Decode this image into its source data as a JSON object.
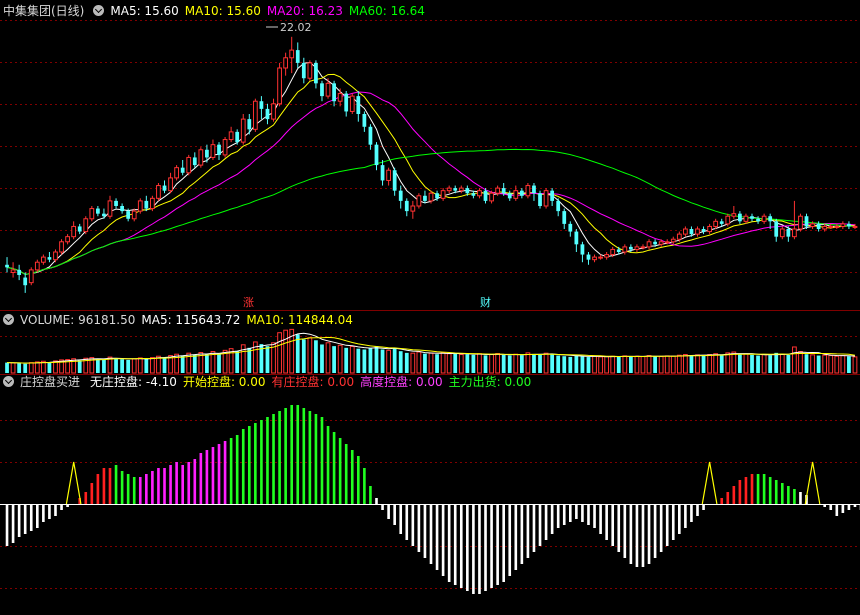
{
  "colors": {
    "up": "#ff3232",
    "down": "#54ffff",
    "ma5": "#ffffff",
    "ma10": "#ffff00",
    "ma20": "#ff00ff",
    "ma60": "#00ff00",
    "grid": "#7f0000",
    "zero": "#ffffff",
    "phase_red": "#ff2020",
    "phase_green": "#20ff20",
    "phase_magenta": "#ff20ff",
    "phase_white": "#ffffff",
    "phase_yellow": "#ffff00"
  },
  "price_panel": {
    "title": "中集集团(日线)",
    "ma5": "MA5: 15.60",
    "ma10": "MA10: 15.60",
    "ma20": "MA20: 16.23",
    "ma60": "MA60: 16.64",
    "peak_label": "22.02",
    "markers": [
      {
        "bar": 44,
        "text": "涨"
      },
      {
        "bar": 90,
        "text": "财"
      }
    ]
  },
  "volume_panel": {
    "label": "VOLUME: 96181.50",
    "ma5": "MA5: 115643.72",
    "ma10": "MA10: 114844.04"
  },
  "indicator_panel": {
    "name": "庄控盘买进",
    "no_control": "无庄控盘: -4.10",
    "start_control": "开始控盘: 0.00",
    "has_control": "有庄控盘: 0.00",
    "high_control": "高度控盘: 0.00",
    "main_out": "主力出货: 0.00"
  },
  "chart_data": [
    {
      "type": "candlestick",
      "title": "中集集团(日线)",
      "annotation_high": 22.02,
      "ohlc_normalized_note": "",
      "candles": [
        [
          13.1,
          13.0,
          12.8,
          13.4
        ],
        [
          12.8,
          12.9,
          12.6,
          13.2
        ],
        [
          12.9,
          12.7,
          12.5,
          13.1
        ],
        [
          12.6,
          12.3,
          12.0,
          12.8
        ],
        [
          12.4,
          12.9,
          12.3,
          13.0
        ],
        [
          12.9,
          13.2,
          12.8,
          13.3
        ],
        [
          13.2,
          13.4,
          13.1,
          13.5
        ],
        [
          13.4,
          13.3,
          13.2,
          13.6
        ],
        [
          13.3,
          13.6,
          13.2,
          13.7
        ],
        [
          13.6,
          14.0,
          13.5,
          14.1
        ],
        [
          14.0,
          14.2,
          13.9,
          14.3
        ],
        [
          14.2,
          14.6,
          14.1,
          14.8
        ],
        [
          14.6,
          14.4,
          14.3,
          14.7
        ],
        [
          14.4,
          14.9,
          14.3,
          15.0
        ],
        [
          14.9,
          15.3,
          14.8,
          15.4
        ],
        [
          15.3,
          15.1,
          15.0,
          15.4
        ],
        [
          15.1,
          15.0,
          14.9,
          15.3
        ],
        [
          15.0,
          15.6,
          14.9,
          15.8
        ],
        [
          15.6,
          15.4,
          15.3,
          15.7
        ],
        [
          15.4,
          15.2,
          15.1,
          15.5
        ],
        [
          15.2,
          14.9,
          14.8,
          15.3
        ],
        [
          14.9,
          15.2,
          14.8,
          15.3
        ],
        [
          15.2,
          15.6,
          15.1,
          15.7
        ],
        [
          15.6,
          15.3,
          15.2,
          15.8
        ],
        [
          15.3,
          15.7,
          15.2,
          15.8
        ],
        [
          15.7,
          16.2,
          15.6,
          16.3
        ],
        [
          16.2,
          16.0,
          15.9,
          16.4
        ],
        [
          16.0,
          16.5,
          15.9,
          16.7
        ],
        [
          16.5,
          16.9,
          16.4,
          17.0
        ],
        [
          16.9,
          16.7,
          16.6,
          17.2
        ],
        [
          16.7,
          17.3,
          16.6,
          17.4
        ],
        [
          17.3,
          17.0,
          16.9,
          17.5
        ],
        [
          17.0,
          17.6,
          16.9,
          17.7
        ],
        [
          17.6,
          17.3,
          17.1,
          17.8
        ],
        [
          17.3,
          17.8,
          17.2,
          18.0
        ],
        [
          17.8,
          17.4,
          17.2,
          17.9
        ],
        [
          17.4,
          18.0,
          17.3,
          18.1
        ],
        [
          18.0,
          18.3,
          17.9,
          18.5
        ],
        [
          18.3,
          17.9,
          17.8,
          18.4
        ],
        [
          17.9,
          18.8,
          17.8,
          19.0
        ],
        [
          18.8,
          18.4,
          18.2,
          19.0
        ],
        [
          18.4,
          19.5,
          18.3,
          19.6
        ],
        [
          19.5,
          19.2,
          18.8,
          19.7
        ],
        [
          19.2,
          18.8,
          18.6,
          19.4
        ],
        [
          18.8,
          19.4,
          18.7,
          19.6
        ],
        [
          19.4,
          20.8,
          19.3,
          21.0
        ],
        [
          20.8,
          21.2,
          20.5,
          21.4
        ],
        [
          21.2,
          21.5,
          20.6,
          22.02
        ],
        [
          21.5,
          21.0,
          20.8,
          21.8
        ],
        [
          21.0,
          20.4,
          20.2,
          21.2
        ],
        [
          20.4,
          21.0,
          20.3,
          21.1
        ],
        [
          21.0,
          20.2,
          20.0,
          21.1
        ],
        [
          20.2,
          19.7,
          19.5,
          20.3
        ],
        [
          19.7,
          20.2,
          19.6,
          20.4
        ],
        [
          20.2,
          19.5,
          19.3,
          20.3
        ],
        [
          19.5,
          19.8,
          19.3,
          20.0
        ],
        [
          19.8,
          19.1,
          18.9,
          19.9
        ],
        [
          19.1,
          19.7,
          19.0,
          19.8
        ],
        [
          19.7,
          19.0,
          18.7,
          19.9
        ],
        [
          19.0,
          18.5,
          18.3,
          19.1
        ],
        [
          18.5,
          17.8,
          17.6,
          18.6
        ],
        [
          17.8,
          17.0,
          16.8,
          17.9
        ],
        [
          17.0,
          16.4,
          16.2,
          17.2
        ],
        [
          16.4,
          16.8,
          16.2,
          16.9
        ],
        [
          16.8,
          16.0,
          15.8,
          16.9
        ],
        [
          16.0,
          15.6,
          15.3,
          16.2
        ],
        [
          15.6,
          15.2,
          15.0,
          15.7
        ],
        [
          15.2,
          15.4,
          14.9,
          15.6
        ],
        [
          15.4,
          15.8,
          15.3,
          15.9
        ],
        [
          15.8,
          15.6,
          15.5,
          16.0
        ],
        [
          15.6,
          15.9,
          15.5,
          16.0
        ],
        [
          15.9,
          15.7,
          15.6,
          16.0
        ],
        [
          15.7,
          16.0,
          15.6,
          16.1
        ],
        [
          16.0,
          16.1,
          15.9,
          16.2
        ],
        [
          16.1,
          16.0,
          15.9,
          16.2
        ],
        [
          16.0,
          16.1,
          15.9,
          16.2
        ],
        [
          16.1,
          15.9,
          15.8,
          16.2
        ],
        [
          15.9,
          15.8,
          15.7,
          16.0
        ],
        [
          15.8,
          16.0,
          15.7,
          16.1
        ],
        [
          16.0,
          15.6,
          15.5,
          16.1
        ],
        [
          15.6,
          15.9,
          15.5,
          16.0
        ],
        [
          15.9,
          16.1,
          15.8,
          16.2
        ],
        [
          16.1,
          15.9,
          15.8,
          16.3
        ],
        [
          15.9,
          15.7,
          15.6,
          16.0
        ],
        [
          15.7,
          16.0,
          15.6,
          16.2
        ],
        [
          16.0,
          15.8,
          15.7,
          16.1
        ],
        [
          15.8,
          16.2,
          15.7,
          16.3
        ],
        [
          16.2,
          15.9,
          15.6,
          16.3
        ],
        [
          15.9,
          15.4,
          15.3,
          16.0
        ],
        [
          15.4,
          16.0,
          15.3,
          16.1
        ],
        [
          16.0,
          15.6,
          15.4,
          16.1
        ],
        [
          15.6,
          15.2,
          15.0,
          15.7
        ],
        [
          15.2,
          14.7,
          14.5,
          15.3
        ],
        [
          14.7,
          14.4,
          14.2,
          14.8
        ],
        [
          14.4,
          13.9,
          13.6,
          14.5
        ],
        [
          13.9,
          13.5,
          13.2,
          14.0
        ],
        [
          13.5,
          13.3,
          13.1,
          13.6
        ],
        [
          13.3,
          13.4,
          13.2,
          13.5
        ],
        [
          13.4,
          13.4,
          13.3,
          13.5
        ],
        [
          13.4,
          13.5,
          13.3,
          13.6
        ],
        [
          13.5,
          13.7,
          13.4,
          13.8
        ],
        [
          13.7,
          13.6,
          13.5,
          13.8
        ],
        [
          13.6,
          13.8,
          13.5,
          13.9
        ],
        [
          13.8,
          13.7,
          13.6,
          13.9
        ],
        [
          13.7,
          13.8,
          13.6,
          13.9
        ],
        [
          13.8,
          13.8,
          13.7,
          13.9
        ],
        [
          13.8,
          14.0,
          13.7,
          14.1
        ],
        [
          14.0,
          13.9,
          13.8,
          14.1
        ],
        [
          13.9,
          14.0,
          13.8,
          14.1
        ],
        [
          14.0,
          14.0,
          13.9,
          14.1
        ],
        [
          14.0,
          14.1,
          13.9,
          14.2
        ],
        [
          14.1,
          14.3,
          14.0,
          14.4
        ],
        [
          14.3,
          14.5,
          14.2,
          14.6
        ],
        [
          14.5,
          14.3,
          14.2,
          14.6
        ],
        [
          14.3,
          14.5,
          14.2,
          14.6
        ],
        [
          14.5,
          14.4,
          14.3,
          14.6
        ],
        [
          14.4,
          14.6,
          14.3,
          14.7
        ],
        [
          14.6,
          14.8,
          14.5,
          14.9
        ],
        [
          14.8,
          14.7,
          14.6,
          14.9
        ],
        [
          14.7,
          15.0,
          14.6,
          15.1
        ],
        [
          15.0,
          15.1,
          14.9,
          15.4
        ],
        [
          15.1,
          14.8,
          14.7,
          15.2
        ],
        [
          14.8,
          15.0,
          14.7,
          15.1
        ],
        [
          15.0,
          14.9,
          14.8,
          15.1
        ],
        [
          14.9,
          14.8,
          14.7,
          15.0
        ],
        [
          14.8,
          15.0,
          14.7,
          15.1
        ],
        [
          15.0,
          14.8,
          14.5,
          15.1
        ],
        [
          14.8,
          14.2,
          14.0,
          14.9
        ],
        [
          14.2,
          14.5,
          14.1,
          14.6
        ],
        [
          14.5,
          14.2,
          14.0,
          14.6
        ],
        [
          14.2,
          14.5,
          14.1,
          15.6
        ],
        [
          14.5,
          15.0,
          14.4,
          15.1
        ],
        [
          15.0,
          14.6,
          14.5,
          15.1
        ],
        [
          14.6,
          14.7,
          14.5,
          14.8
        ],
        [
          14.7,
          14.5,
          14.4,
          14.8
        ],
        [
          14.5,
          14.6,
          14.4,
          14.7
        ],
        [
          14.6,
          14.6,
          14.5,
          14.7
        ],
        [
          14.6,
          14.6,
          14.5,
          14.7
        ],
        [
          14.6,
          14.7,
          14.5,
          14.8
        ],
        [
          14.7,
          14.6,
          14.5,
          14.8
        ],
        [
          14.6,
          14.6,
          14.5,
          14.7
        ]
      ],
      "ma5_ref": 15.6,
      "ma10_ref": 15.6,
      "ma20_ref": 16.23,
      "ma60_ref": 16.64,
      "ylim": [
        11.8,
        22.6
      ]
    },
    {
      "type": "bar",
      "title": "VOLUME",
      "last": 96181.5,
      "ma5": 115643.72,
      "ma10": 114844.04,
      "values": [
        62,
        60,
        58,
        55,
        62,
        66,
        70,
        64,
        72,
        78,
        80,
        85,
        75,
        88,
        92,
        86,
        80,
        95,
        88,
        82,
        78,
        84,
        90,
        86,
        92,
        100,
        94,
        104,
        112,
        105,
        118,
        108,
        122,
        112,
        128,
        115,
        135,
        145,
        130,
        168,
        150,
        185,
        172,
        160,
        180,
        240,
        255,
        260,
        230,
        200,
        210,
        195,
        170,
        180,
        160,
        165,
        150,
        158,
        145,
        140,
        150,
        160,
        140,
        135,
        150,
        130,
        120,
        118,
        125,
        115,
        118,
        112,
        120,
        115,
        118,
        110,
        112,
        108,
        115,
        105,
        110,
        116,
        108,
        104,
        112,
        106,
        120,
        112,
        108,
        118,
        110,
        104,
        100,
        96,
        105,
        98,
        95,
        100,
        96,
        98,
        100,
        97,
        102,
        98,
        100,
        98,
        104,
        100,
        98,
        102,
        100,
        106,
        110,
        104,
        108,
        105,
        110,
        115,
        108,
        120,
        125,
        110,
        114,
        108,
        104,
        110,
        106,
        120,
        112,
        108,
        155,
        128,
        112,
        108,
        104,
        106,
        104,
        100,
        104,
        100,
        96
      ],
      "ylim": [
        0,
        280
      ]
    },
    {
      "type": "bar",
      "title": "庄控盘买进",
      "values": [
        -14,
        -13,
        -11,
        -10,
        -9,
        -8,
        -6,
        -5,
        -4,
        -2,
        -1,
        0,
        2,
        4,
        7,
        10,
        12,
        12,
        13,
        11,
        10,
        9,
        9,
        10,
        11,
        12,
        12,
        13,
        14,
        13,
        14,
        15,
        17,
        18,
        19,
        20,
        21,
        22,
        23,
        25,
        26,
        27,
        28,
        29,
        30,
        31,
        32,
        33,
        33,
        32,
        31,
        30,
        29,
        26,
        24,
        22,
        20,
        18,
        16,
        12,
        6,
        2,
        -2,
        -5,
        -7,
        -10,
        -12,
        -14,
        -16,
        -18,
        -20,
        -22,
        -24,
        -26,
        -27,
        -28,
        -29,
        -30,
        -30,
        -29,
        -28,
        -27,
        -26,
        -24,
        -22,
        -20,
        -18,
        -16,
        -14,
        -12,
        -10,
        -8,
        -7,
        -6,
        -5,
        -6,
        -7,
        -8,
        -10,
        -12,
        -14,
        -16,
        -18,
        -20,
        -21,
        -21,
        -20,
        -18,
        -16,
        -14,
        -12,
        -10,
        -8,
        -6,
        -4,
        -2,
        -1,
        0,
        2,
        4,
        6,
        8,
        9,
        10,
        10,
        10,
        9,
        8,
        7,
        6,
        5,
        4,
        3,
        1,
        0,
        -1,
        -2,
        -4,
        -3,
        -2,
        -1,
        -2,
        -3,
        -3,
        -4.1
      ],
      "phase": [
        "white",
        "white",
        "white",
        "white",
        "white",
        "white",
        "white",
        "white",
        "white",
        "white",
        "white",
        "yellow",
        "red",
        "red",
        "red",
        "red",
        "red",
        "red",
        "green",
        "green",
        "green",
        "green",
        "magenta",
        "magenta",
        "magenta",
        "magenta",
        "magenta",
        "magenta",
        "magenta",
        "magenta",
        "magenta",
        "magenta",
        "magenta",
        "magenta",
        "magenta",
        "magenta",
        "magenta",
        "green",
        "green",
        "green",
        "green",
        "green",
        "green",
        "green",
        "green",
        "green",
        "green",
        "green",
        "green",
        "green",
        "green",
        "green",
        "green",
        "green",
        "green",
        "green",
        "green",
        "green",
        "green",
        "green",
        "green",
        "white",
        "white",
        "white",
        "white",
        "white",
        "white",
        "white",
        "white",
        "white",
        "white",
        "white",
        "white",
        "white",
        "white",
        "white",
        "white",
        "white",
        "white",
        "white",
        "white",
        "white",
        "white",
        "white",
        "white",
        "white",
        "white",
        "white",
        "white",
        "white",
        "white",
        "white",
        "white",
        "white",
        "white",
        "white",
        "white",
        "white",
        "white",
        "white",
        "white",
        "white",
        "white",
        "white",
        "white",
        "white",
        "white",
        "white",
        "white",
        "white",
        "white",
        "white",
        "white",
        "white",
        "white",
        "white",
        "yellow",
        "red",
        "red",
        "red",
        "red",
        "red",
        "red",
        "red",
        "green",
        "green",
        "green",
        "green",
        "green",
        "green",
        "green",
        "white",
        "white",
        "yellow",
        "white",
        "white",
        "white",
        "white",
        "white",
        "white",
        "white",
        "white",
        "white",
        "white",
        "white"
      ],
      "ylim": [
        -36,
        36
      ]
    }
  ]
}
